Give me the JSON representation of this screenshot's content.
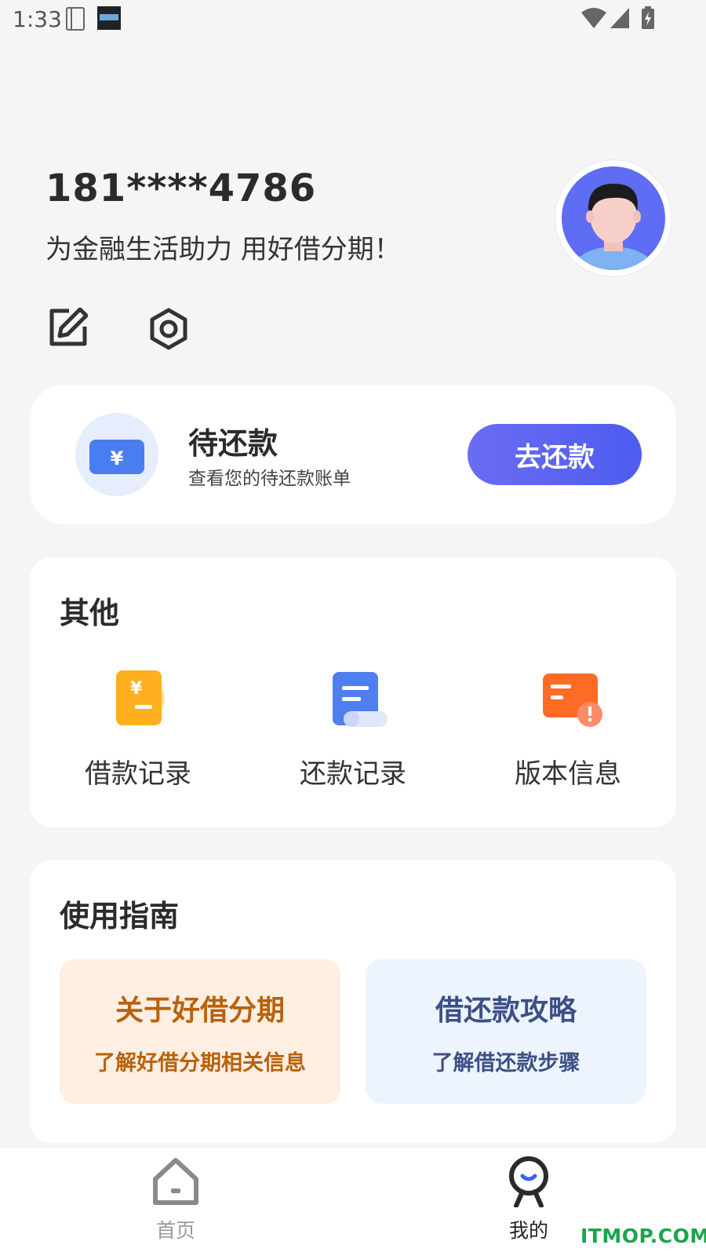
{
  "status_bar": {
    "time": "1:33"
  },
  "profile": {
    "phone": "181****4786",
    "slogan": "为金融生活助力 用好借分期！"
  },
  "toolbar": {
    "edit_icon": "edit-icon",
    "settings_icon": "settings-icon"
  },
  "repay_card": {
    "title": "待还款",
    "subtitle": "查看您的待还款账单",
    "button_label": "去还款",
    "icon": "yuan-card-icon"
  },
  "other": {
    "title": "其他",
    "items": [
      {
        "label": "借款记录",
        "icon": "loan-record-icon"
      },
      {
        "label": "还款记录",
        "icon": "repay-record-icon"
      },
      {
        "label": "版本信息",
        "icon": "version-info-icon"
      }
    ]
  },
  "guide": {
    "title": "使用指南",
    "items": [
      {
        "title": "关于好借分期",
        "subtitle": "了解好借分期相关信息"
      },
      {
        "title": "借还款攻略",
        "subtitle": "了解借还款步骤"
      }
    ]
  },
  "bottom_nav": {
    "items": [
      {
        "label": "首页",
        "icon": "home-icon",
        "active": false
      },
      {
        "label": "我的",
        "icon": "mine-icon",
        "active": true
      }
    ]
  },
  "watermark": "ITMOP.COM",
  "colors": {
    "accent": "#5b63f1",
    "guide_orange_text": "#b8620b",
    "guide_blue_text": "#3c4f88",
    "background": "#f5f5f6"
  }
}
